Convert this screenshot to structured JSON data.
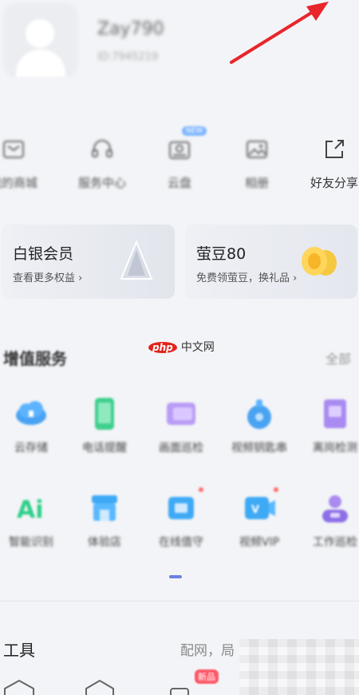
{
  "profile": {
    "avatar_icon": "user-avatar-icon",
    "username": "Zay790",
    "subtitle": "ID:7945219"
  },
  "quick_actions": [
    {
      "label": "我的商城",
      "icon": "mail-icon"
    },
    {
      "label": "服务中心",
      "icon": "headset-icon"
    },
    {
      "label": "云盘",
      "icon": "cloud-drive-icon",
      "badge": "NEW"
    },
    {
      "label": "相册",
      "icon": "photo-icon"
    },
    {
      "label": "好友分享",
      "icon": "share-icon"
    }
  ],
  "cards": {
    "silver": {
      "title": "白银会员",
      "subtitle": "查看更多权益 ›"
    },
    "beans": {
      "title": "萤豆80",
      "subtitle": "免费领萤豆，换礼品 ›"
    }
  },
  "value_services": {
    "title": "增值服务",
    "all_label": "全部",
    "row1": [
      {
        "label": "云存储",
        "icon": "cloud-storage-icon"
      },
      {
        "label": "电话提醒",
        "icon": "phone-alert-icon"
      },
      {
        "label": "画面巡检",
        "icon": "screen-inspect-icon"
      },
      {
        "label": "视频钥匙串",
        "icon": "video-key-icon"
      },
      {
        "label": "离岗检测",
        "icon": "absence-detect-icon"
      }
    ],
    "row2": [
      {
        "label": "智能识别",
        "icon": "ai-icon"
      },
      {
        "label": "体验店",
        "icon": "store-icon"
      },
      {
        "label": "在线值守",
        "icon": "online-guard-icon",
        "dot": true
      },
      {
        "label": "视频VIP",
        "icon": "video-vip-icon",
        "dot": true
      },
      {
        "label": "工作巡检",
        "icon": "work-inspect-icon"
      }
    ]
  },
  "watermark": {
    "brand": "php",
    "text": "中文网"
  },
  "tools": {
    "title": "工具",
    "subtitle": "配网，局"
  },
  "bottom_badge": "新品",
  "colors": {
    "accent": "#6f7fe0",
    "arrow": "#e8262b",
    "badge_red": "#ff5a6a"
  }
}
